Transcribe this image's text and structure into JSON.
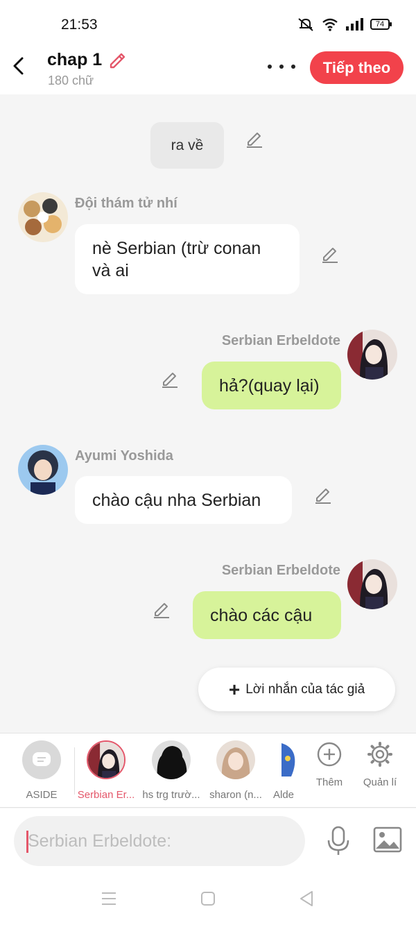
{
  "status": {
    "time": "21:53",
    "battery": "74"
  },
  "header": {
    "title": "chap 1",
    "word_count": "180 chữ",
    "next_label": "Tiếp theo"
  },
  "chat": {
    "narration": "ra về",
    "messages": [
      {
        "sender": "Đội thám tử nhí",
        "line1": "nè Serbian (trừ conan",
        "line2": "và ai"
      },
      {
        "sender": "Serbian Erbeldote",
        "text": "hả?(quay lại)"
      },
      {
        "sender": "Ayumi Yoshida",
        "text": "chào cậu nha Serbian"
      },
      {
        "sender": "Serbian Erbeldote",
        "text": "chào các cậu"
      }
    ],
    "author_note_label": "Lời nhắn của tác giả"
  },
  "characters": [
    {
      "label": "ASIDE",
      "icon": "aside-chat-icon"
    },
    {
      "label": "Serbian Er...",
      "active": true
    },
    {
      "label": "hs trg trườ..."
    },
    {
      "label": "sharon (n..."
    },
    {
      "label": "Alde"
    },
    {
      "label": "Thêm",
      "icon": "plus-circle-icon"
    },
    {
      "label": "Quản lí",
      "icon": "gear-icon"
    }
  ],
  "input": {
    "placeholder": "Serbian Erbeldote:"
  },
  "colors": {
    "accent": "#f2424b",
    "bubble_self": "#d7f39a",
    "bubble_other": "#ffffff",
    "active_char": "#e4576a"
  }
}
